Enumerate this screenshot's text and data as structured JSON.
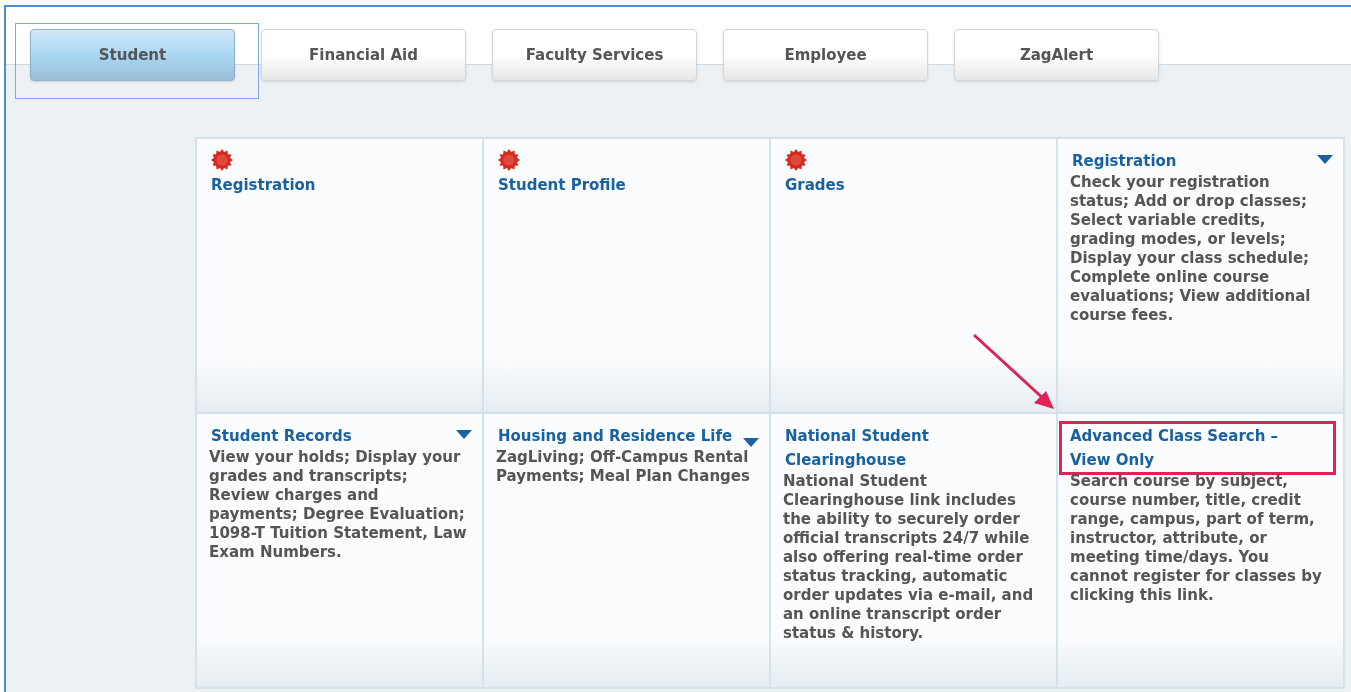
{
  "tabs": [
    {
      "label": "Student",
      "selected": true
    },
    {
      "label": "Financial Aid",
      "selected": false
    },
    {
      "label": "Faculty Services",
      "selected": false
    },
    {
      "label": "Employee",
      "selected": false
    },
    {
      "label": "ZagAlert",
      "selected": false
    }
  ],
  "tiles": [
    {
      "title": "Registration",
      "new": true,
      "menu": false,
      "highlighted": false
    },
    {
      "title": "Student Profile",
      "new": true,
      "menu": false,
      "highlighted": false
    },
    {
      "title": "Grades",
      "new": true,
      "menu": false,
      "highlighted": false
    },
    {
      "title": "Registration",
      "description": "Check your registration status; Add or drop classes; Select variable credits, grading modes, or levels; Display your class schedule; Complete online course evaluations; View additional course fees.",
      "new": false,
      "menu": true,
      "highlighted": false
    },
    {
      "title": "Student Records",
      "description": "View your holds; Display your grades and transcripts; Review charges and payments; Degree Evaluation; 1098-T Tuition Statement, Law Exam Numbers.",
      "new": false,
      "menu": true,
      "highlighted": false
    },
    {
      "title": "Housing and Residence Life",
      "description": "ZagLiving; Off-Campus Rental Payments; Meal Plan Changes",
      "new": false,
      "menu": true,
      "highlighted": false
    },
    {
      "title": "National Student Clearinghouse",
      "description": "National Student Clearinghouse link includes the ability to securely order official transcripts 24/7 while also offering real-time order status tracking, automatic order updates via e-mail, and an online transcript order status & history.",
      "new": false,
      "menu": false,
      "highlighted": false
    },
    {
      "title": "Advanced Class Search – View Only",
      "description": "Search course by subject, course number, title, credit range, campus, part of term, instructor, attribute, or meeting time/days. You cannot register for classes by clicking this link.",
      "new": false,
      "menu": false,
      "highlighted": true
    }
  ]
}
